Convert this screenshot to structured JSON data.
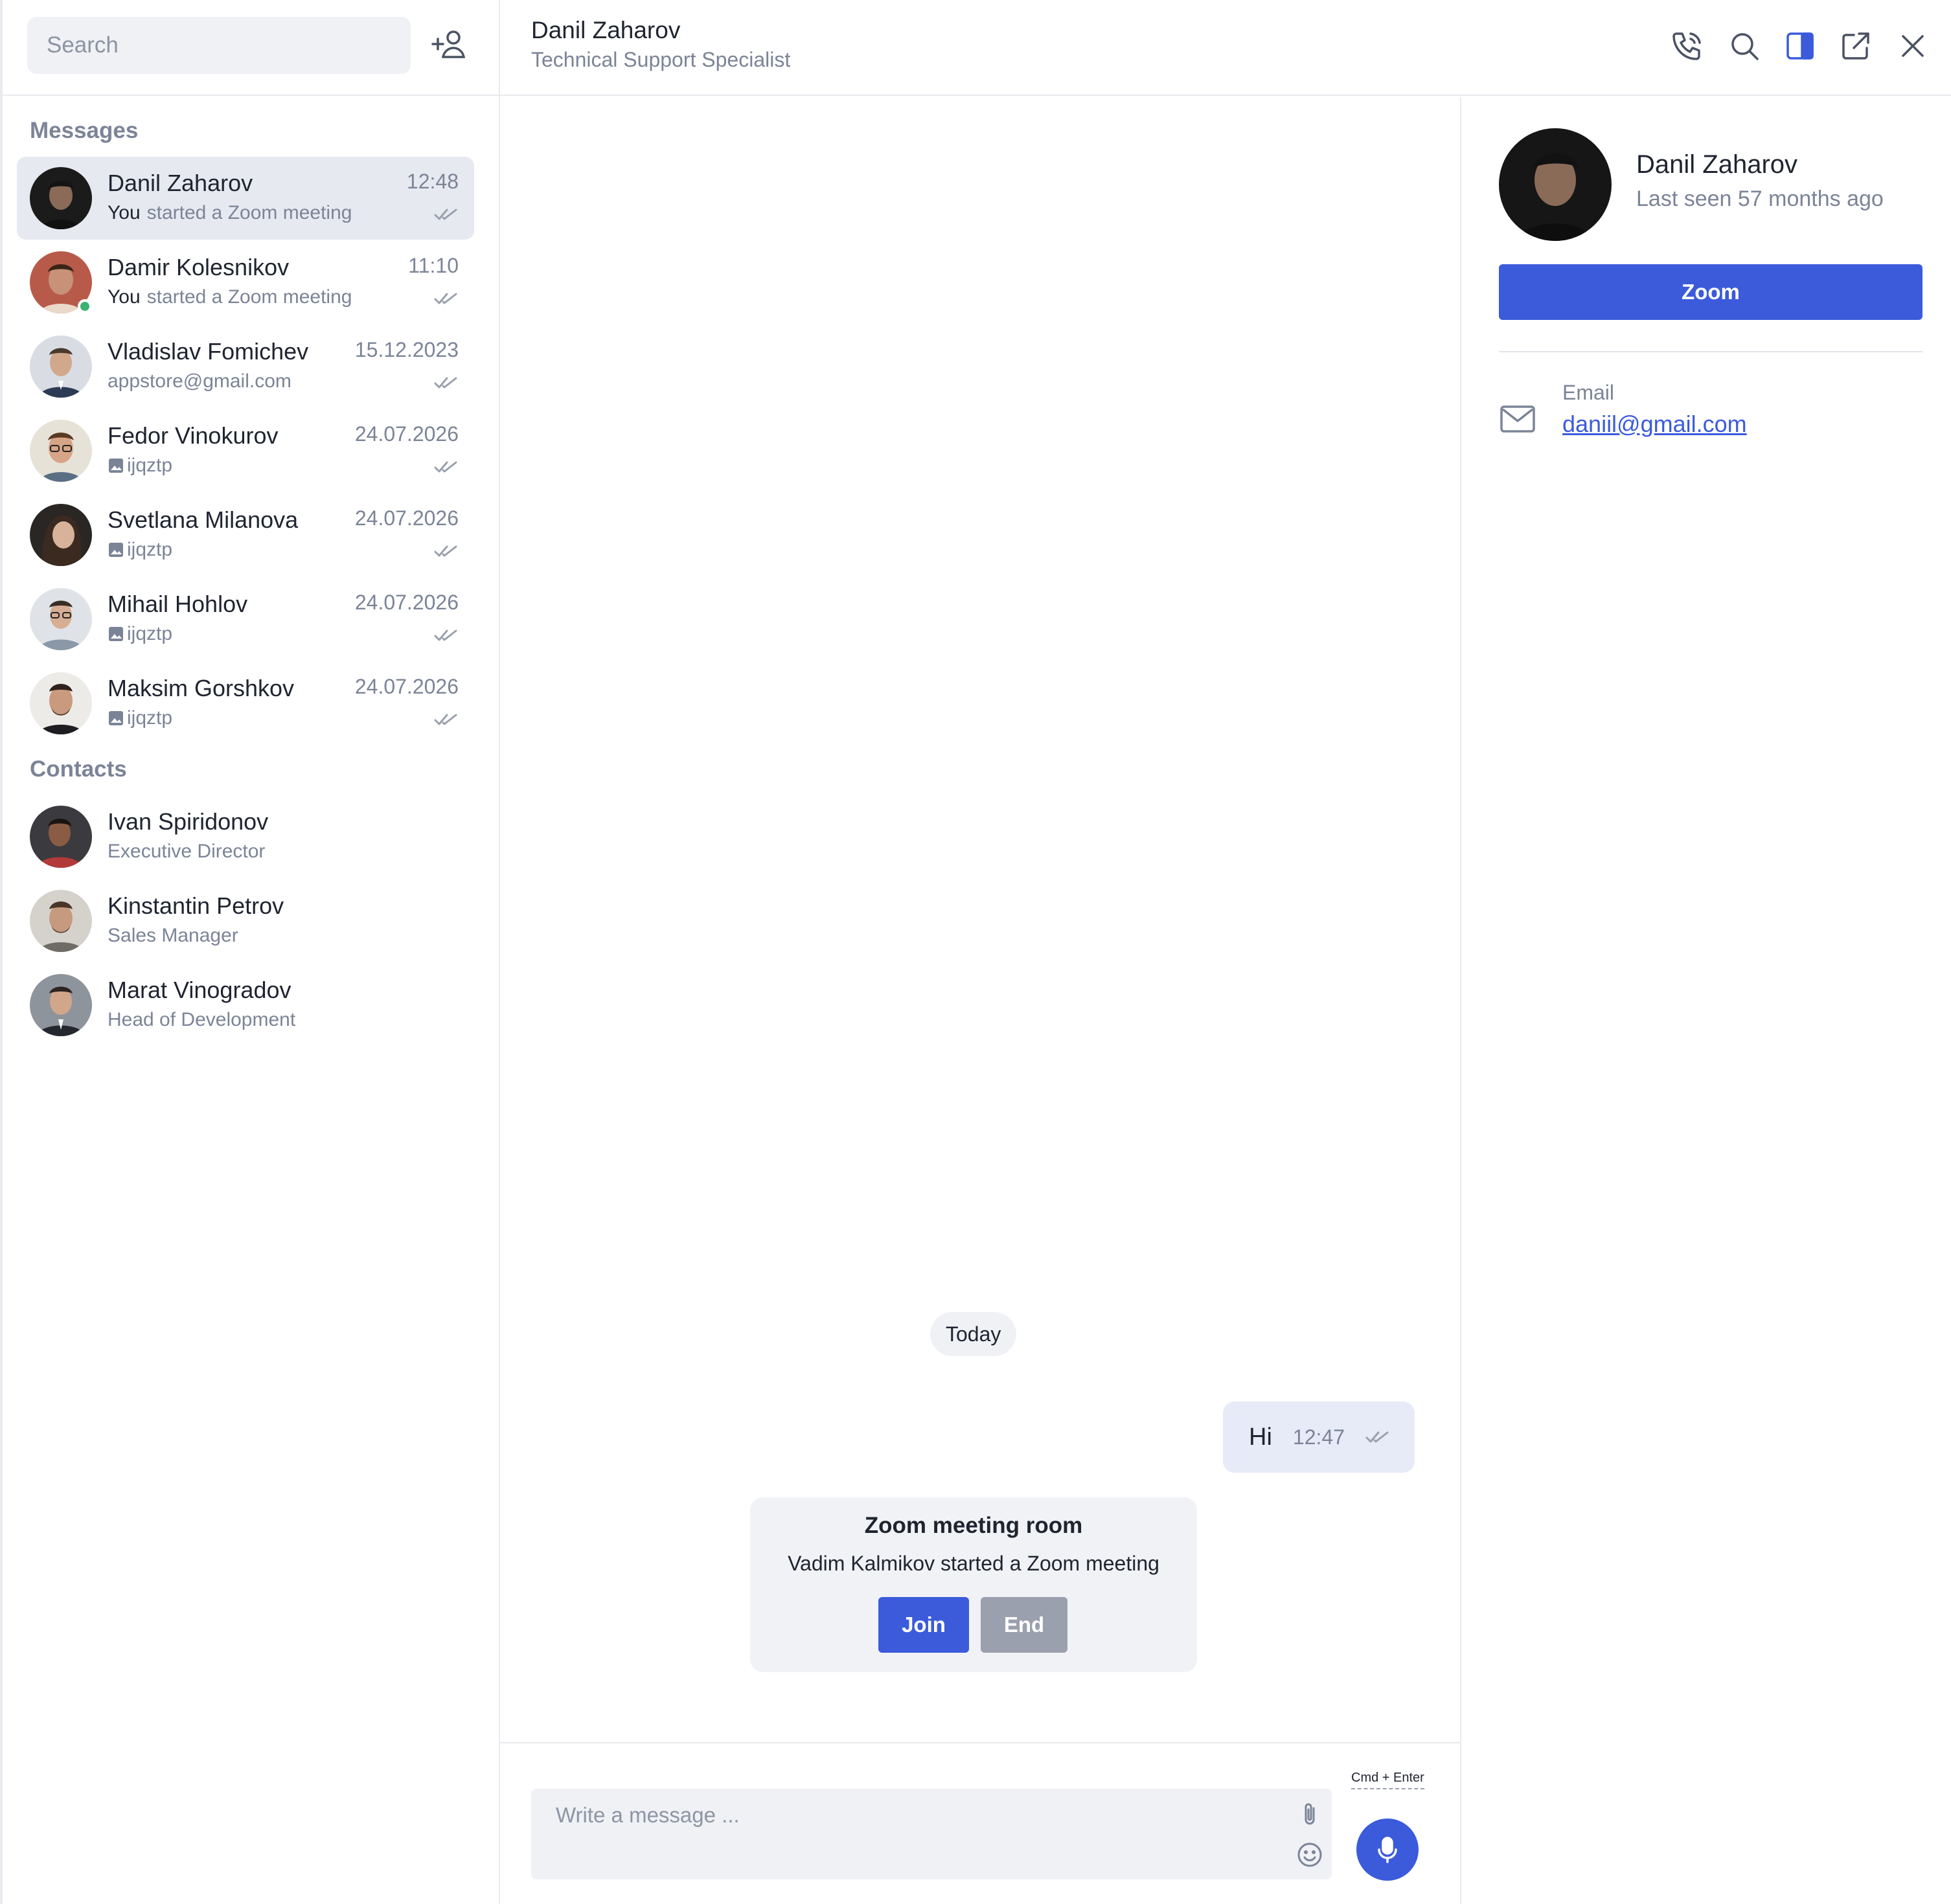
{
  "search": {
    "placeholder": "Search"
  },
  "sections": {
    "messages": "Messages",
    "contacts": "Contacts"
  },
  "chats": [
    {
      "name": "Danil Zaharov",
      "prefix": "You",
      "preview": "started a Zoom meeting",
      "time": "12:48",
      "active": true
    },
    {
      "name": "Damir Kolesnikov",
      "prefix": "You",
      "preview": "started a Zoom meeting",
      "time": "11:10",
      "online": true
    },
    {
      "name": "Vladislav Fomichev",
      "prefix": "",
      "preview": "appstore@gmail.com",
      "time": "15.12.2023"
    },
    {
      "name": "Fedor Vinokurov",
      "prefix": "",
      "preview": "ijqztp",
      "time": "24.07.2026",
      "attachment": true
    },
    {
      "name": "Svetlana Milanova",
      "prefix": "",
      "preview": "ijqztp",
      "time": "24.07.2026",
      "attachment": true
    },
    {
      "name": "Mihail Hohlov",
      "prefix": "",
      "preview": "ijqztp",
      "time": "24.07.2026",
      "attachment": true
    },
    {
      "name": "Maksim Gorshkov",
      "prefix": "",
      "preview": "ijqztp",
      "time": "24.07.2026",
      "attachment": true
    }
  ],
  "contacts": [
    {
      "name": "Ivan Spiridonov",
      "role": "Executive Director"
    },
    {
      "name": "Kinstantin Petrov",
      "role": "Sales Manager"
    },
    {
      "name": "Marat Vinogradov",
      "role": "Head of Development"
    }
  ],
  "header": {
    "name": "Danil Zaharov",
    "role": "Technical Support Specialist"
  },
  "conversation": {
    "day": "Today",
    "messages": [
      {
        "text": "Hi",
        "time": "12:47"
      }
    ],
    "zoom_card": {
      "title": "Zoom meeting room",
      "description": "Vadim Kalmikov started a Zoom meeting",
      "join_label": "Join",
      "end_label": "End"
    }
  },
  "composer": {
    "placeholder": "Write a message ...",
    "shortcut": "Cmd + Enter"
  },
  "details": {
    "name": "Danil Zaharov",
    "last_seen": "Last seen 57 months ago",
    "zoom_label": "Zoom",
    "email_label": "Email",
    "email": "daniil@gmail.com"
  },
  "icons": {
    "header": [
      "phone-icon",
      "search-icon",
      "sidebar-panel-icon",
      "open-external-icon",
      "close-icon"
    ],
    "composer": [
      "paperclip-icon",
      "emoji-icon",
      "microphone-icon"
    ],
    "sidebar": [
      "add-contact-icon",
      "image-icon",
      "double-check-icon"
    ],
    "details": [
      "mail-icon"
    ]
  },
  "colors": {
    "accent": "#3b5bdb",
    "muted": "#7b8497",
    "active_row": "#e7e9f1",
    "online": "#3cb371",
    "end_button": "#9aa0ad"
  }
}
